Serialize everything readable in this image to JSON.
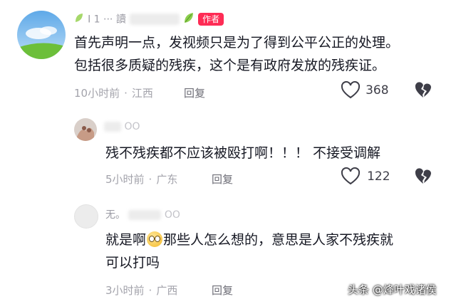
{
  "comments": [
    {
      "username": "I 1 ··· 讀",
      "author_badge": "作者",
      "text_line1": "首先声明一点，发视频只是为了得到公平公正的处理。",
      "text_line2": "包括很多质疑的残疾，这个是有政府发放的残疾证。",
      "time": "10小时前",
      "dot": "·",
      "location": "江西",
      "reply_label": "回复",
      "like_count": "368",
      "like_icon": "heart-outline-icon",
      "dislike_icon": "broken-heart-icon"
    },
    {
      "username": "OO",
      "text_line1": "残不残疾都不应该被殴打啊！！！  不接受调解",
      "time": "5小时前",
      "dot": "·",
      "location": "广东",
      "reply_label": "回复",
      "like_count": "122"
    },
    {
      "username_prefix": "无。",
      "username_suffix": "OO",
      "text_line1_a": "就是啊",
      "text_line1_b": "那些人怎么想的，意思是人家不残疾就",
      "text_line2": "可以打吗",
      "emoji_icon": "sweating-face-emoji-icon",
      "time": "3小时前",
      "dot": "·",
      "location": "广西",
      "reply_label": "回复"
    }
  ],
  "watermark": "头条 @烽叶戏诸侯",
  "colors": {
    "badge": "#fe2c55",
    "meta": "#a3a3ab",
    "text": "#161823"
  }
}
